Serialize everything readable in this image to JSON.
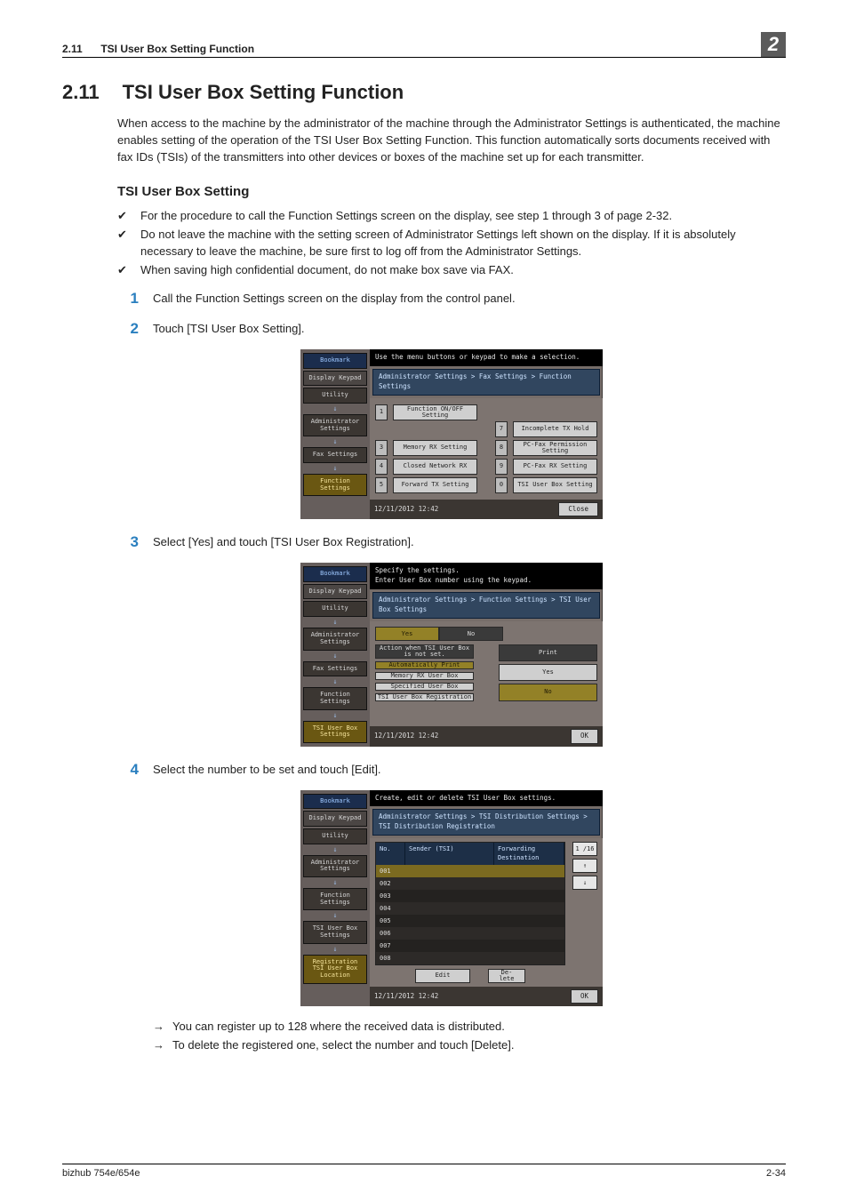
{
  "header": {
    "section_no": "2.11",
    "section_title": "TSI User Box Setting Function",
    "page_tab": "2"
  },
  "h1": {
    "no": "2.11",
    "title": "TSI User Box Setting Function"
  },
  "intro": "When access to the machine by the administrator of the machine through the Administrator Settings is authenticated, the machine enables setting of the operation of the TSI User Box Setting Function. This function automatically sorts documents received with fax IDs (TSIs) of the transmitters into other devices or boxes of the machine set up for each transmitter.",
  "h2": "TSI User Box Setting",
  "checks": [
    "For the procedure to call the Function Settings screen on the display, see step 1 through 3 of page 2-32.",
    "Do not leave the machine with the setting screen of Administrator Settings left shown on the display. If it is absolutely necessary to leave the machine, be sure first to log off from the Administrator Settings.",
    "When saving high confidential document, do not make box save via FAX."
  ],
  "steps": {
    "s1": "Call the Function Settings screen on the display from the control panel.",
    "s2": "Touch [TSI User Box Setting].",
    "s3": "Select [Yes] and touch [TSI User Box Registration].",
    "s4": "Select the number to be set and touch [Edit]."
  },
  "arrows": [
    "You can register up to 128 where the received data is distributed.",
    "To delete the registered one, select the number and touch [Delete]."
  ],
  "footer": {
    "left": "bizhub 754e/654e",
    "right": "2-34"
  },
  "screen1": {
    "topmsg": "Use the menu buttons or keypad to make a selection.",
    "crumb": "Administrator Settings > Fax Settings > Function Settings",
    "side": {
      "bookmark": "Bookmark",
      "display": "Display Keypad",
      "utility": "Utility",
      "admin": "Administrator Settings",
      "fax": "Fax Settings",
      "func": "Function Settings"
    },
    "items": {
      "i1": {
        "n": "1",
        "t": "Function ON/OFF Setting"
      },
      "i3": {
        "n": "3",
        "t": "Memory RX Setting"
      },
      "i4": {
        "n": "4",
        "t": "Closed Network RX"
      },
      "i5": {
        "n": "5",
        "t": "Forward TX Setting"
      },
      "i7": {
        "n": "7",
        "t": "Incomplete TX Hold"
      },
      "i8": {
        "n": "8",
        "t": "PC-Fax Permission Setting"
      },
      "i9": {
        "n": "9",
        "t": "PC-Fax RX Setting"
      },
      "i0": {
        "n": "0",
        "t": "TSI User Box Setting"
      }
    },
    "datetime": "12/11/2012   12:42",
    "close": "Close"
  },
  "screen2": {
    "topmsg": "Specify the settings.\nEnter User Box number using the keypad.",
    "crumb": "Administrator Settings > Function Settings > TSI User Box Settings",
    "side": {
      "bookmark": "Bookmark",
      "display": "Display Keypad",
      "utility": "Utility",
      "admin": "Administrator Settings",
      "fax": "Fax Settings",
      "func": "Function Settings",
      "tsi": "TSI User Box Settings"
    },
    "tabs": {
      "yes": "Yes",
      "no": "No"
    },
    "left": {
      "a": "Action when TSI User Box is not set.",
      "b": "Automatically Print",
      "c": "Memory RX User Box",
      "d": "Specified User Box",
      "e": "TSI User Box Registration"
    },
    "right": {
      "print": "Print",
      "yes": "Yes",
      "no": "No"
    },
    "datetime": "12/11/2012   12:42",
    "ok": "OK"
  },
  "screen3": {
    "topmsg": "Create, edit or delete TSI User Box settings.",
    "crumb": "Administrator Settings > TSI Distribution Settings > TSI Distribution Registration",
    "side": {
      "bookmark": "Bookmark",
      "display": "Display Keypad",
      "utility": "Utility",
      "admin": "Administrator Settings",
      "func": "Function Settings",
      "tsi": "TSI User Box Settings",
      "reg": "Registration TSI User Box Location"
    },
    "cols": {
      "c1": "No.",
      "c2": "Sender (TSI)",
      "c3": "Forwarding Destination"
    },
    "rows": {
      "r1": "001",
      "r2": "002",
      "r3": "003",
      "r4": "004",
      "r5": "005",
      "r6": "006",
      "r7": "007",
      "r8": "008"
    },
    "pager": {
      "label": "1 /16",
      "up": "↑",
      "down": "↓"
    },
    "edit": "Edit",
    "delete": "De-\nlete",
    "datetime": "12/11/2012   12:42",
    "ok": "OK"
  }
}
